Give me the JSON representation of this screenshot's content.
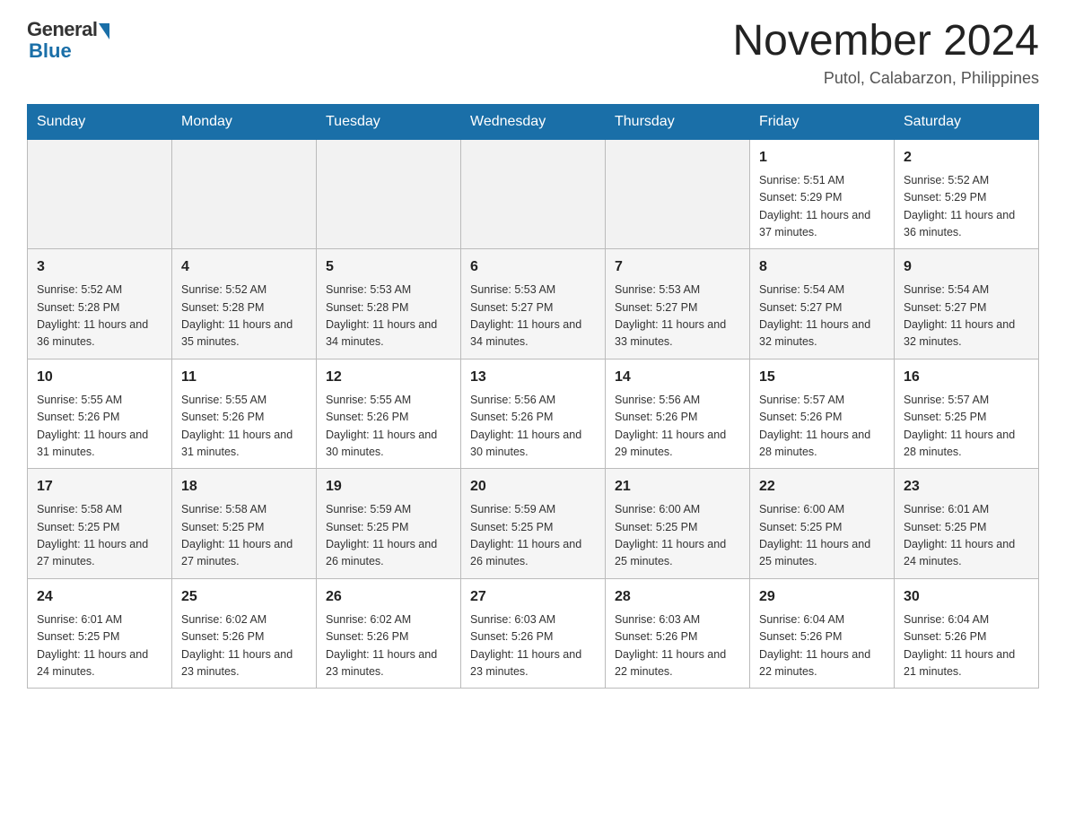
{
  "logo": {
    "general": "General",
    "blue": "Blue"
  },
  "header": {
    "title": "November 2024",
    "location": "Putol, Calabarzon, Philippines"
  },
  "days_of_week": [
    "Sunday",
    "Monday",
    "Tuesday",
    "Wednesday",
    "Thursday",
    "Friday",
    "Saturday"
  ],
  "weeks": [
    [
      {
        "day": "",
        "info": ""
      },
      {
        "day": "",
        "info": ""
      },
      {
        "day": "",
        "info": ""
      },
      {
        "day": "",
        "info": ""
      },
      {
        "day": "",
        "info": ""
      },
      {
        "day": "1",
        "info": "Sunrise: 5:51 AM\nSunset: 5:29 PM\nDaylight: 11 hours and 37 minutes."
      },
      {
        "day": "2",
        "info": "Sunrise: 5:52 AM\nSunset: 5:29 PM\nDaylight: 11 hours and 36 minutes."
      }
    ],
    [
      {
        "day": "3",
        "info": "Sunrise: 5:52 AM\nSunset: 5:28 PM\nDaylight: 11 hours and 36 minutes."
      },
      {
        "day": "4",
        "info": "Sunrise: 5:52 AM\nSunset: 5:28 PM\nDaylight: 11 hours and 35 minutes."
      },
      {
        "day": "5",
        "info": "Sunrise: 5:53 AM\nSunset: 5:28 PM\nDaylight: 11 hours and 34 minutes."
      },
      {
        "day": "6",
        "info": "Sunrise: 5:53 AM\nSunset: 5:27 PM\nDaylight: 11 hours and 34 minutes."
      },
      {
        "day": "7",
        "info": "Sunrise: 5:53 AM\nSunset: 5:27 PM\nDaylight: 11 hours and 33 minutes."
      },
      {
        "day": "8",
        "info": "Sunrise: 5:54 AM\nSunset: 5:27 PM\nDaylight: 11 hours and 32 minutes."
      },
      {
        "day": "9",
        "info": "Sunrise: 5:54 AM\nSunset: 5:27 PM\nDaylight: 11 hours and 32 minutes."
      }
    ],
    [
      {
        "day": "10",
        "info": "Sunrise: 5:55 AM\nSunset: 5:26 PM\nDaylight: 11 hours and 31 minutes."
      },
      {
        "day": "11",
        "info": "Sunrise: 5:55 AM\nSunset: 5:26 PM\nDaylight: 11 hours and 31 minutes."
      },
      {
        "day": "12",
        "info": "Sunrise: 5:55 AM\nSunset: 5:26 PM\nDaylight: 11 hours and 30 minutes."
      },
      {
        "day": "13",
        "info": "Sunrise: 5:56 AM\nSunset: 5:26 PM\nDaylight: 11 hours and 30 minutes."
      },
      {
        "day": "14",
        "info": "Sunrise: 5:56 AM\nSunset: 5:26 PM\nDaylight: 11 hours and 29 minutes."
      },
      {
        "day": "15",
        "info": "Sunrise: 5:57 AM\nSunset: 5:26 PM\nDaylight: 11 hours and 28 minutes."
      },
      {
        "day": "16",
        "info": "Sunrise: 5:57 AM\nSunset: 5:25 PM\nDaylight: 11 hours and 28 minutes."
      }
    ],
    [
      {
        "day": "17",
        "info": "Sunrise: 5:58 AM\nSunset: 5:25 PM\nDaylight: 11 hours and 27 minutes."
      },
      {
        "day": "18",
        "info": "Sunrise: 5:58 AM\nSunset: 5:25 PM\nDaylight: 11 hours and 27 minutes."
      },
      {
        "day": "19",
        "info": "Sunrise: 5:59 AM\nSunset: 5:25 PM\nDaylight: 11 hours and 26 minutes."
      },
      {
        "day": "20",
        "info": "Sunrise: 5:59 AM\nSunset: 5:25 PM\nDaylight: 11 hours and 26 minutes."
      },
      {
        "day": "21",
        "info": "Sunrise: 6:00 AM\nSunset: 5:25 PM\nDaylight: 11 hours and 25 minutes."
      },
      {
        "day": "22",
        "info": "Sunrise: 6:00 AM\nSunset: 5:25 PM\nDaylight: 11 hours and 25 minutes."
      },
      {
        "day": "23",
        "info": "Sunrise: 6:01 AM\nSunset: 5:25 PM\nDaylight: 11 hours and 24 minutes."
      }
    ],
    [
      {
        "day": "24",
        "info": "Sunrise: 6:01 AM\nSunset: 5:25 PM\nDaylight: 11 hours and 24 minutes."
      },
      {
        "day": "25",
        "info": "Sunrise: 6:02 AM\nSunset: 5:26 PM\nDaylight: 11 hours and 23 minutes."
      },
      {
        "day": "26",
        "info": "Sunrise: 6:02 AM\nSunset: 5:26 PM\nDaylight: 11 hours and 23 minutes."
      },
      {
        "day": "27",
        "info": "Sunrise: 6:03 AM\nSunset: 5:26 PM\nDaylight: 11 hours and 23 minutes."
      },
      {
        "day": "28",
        "info": "Sunrise: 6:03 AM\nSunset: 5:26 PM\nDaylight: 11 hours and 22 minutes."
      },
      {
        "day": "29",
        "info": "Sunrise: 6:04 AM\nSunset: 5:26 PM\nDaylight: 11 hours and 22 minutes."
      },
      {
        "day": "30",
        "info": "Sunrise: 6:04 AM\nSunset: 5:26 PM\nDaylight: 11 hours and 21 minutes."
      }
    ]
  ]
}
